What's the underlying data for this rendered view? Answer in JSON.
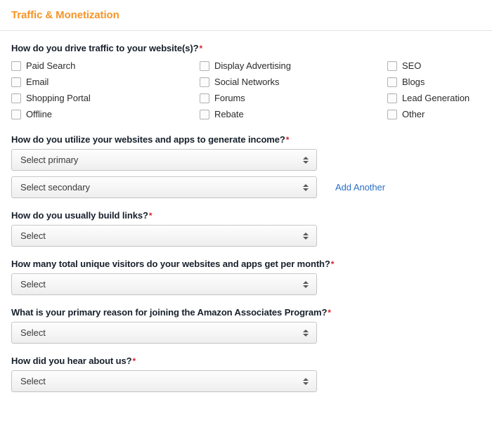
{
  "header": {
    "title": "Traffic & Monetization",
    "title_color": "#f79426"
  },
  "colors": {
    "accent": "#f79426",
    "required_asterisk": "#d9232e",
    "link": "#2b6fc4",
    "label_text": "#17202b"
  },
  "required_marker": "*",
  "questions": {
    "traffic_sources": {
      "label": "How do you drive traffic to your website(s)?",
      "required": true,
      "columns": [
        [
          "Paid Search",
          "Email",
          "Shopping Portal",
          "Offline"
        ],
        [
          "Display Advertising",
          "Social Networks",
          "Forums",
          "Rebate"
        ],
        [
          "SEO",
          "Blogs",
          "Lead Generation",
          "Other"
        ]
      ]
    },
    "monetization": {
      "label": "How do you utilize your websites and apps to generate income?",
      "required": true,
      "primary_value": "Select primary",
      "secondary_value": "Select secondary",
      "add_another_label": "Add Another"
    },
    "build_links": {
      "label": "How do you usually build links?",
      "required": true,
      "value": "Select"
    },
    "unique_visitors": {
      "label": "How many total unique visitors do your websites and apps get per month?",
      "required": true,
      "value": "Select"
    },
    "primary_reason": {
      "label": "What is your primary reason for joining the Amazon Associates Program?",
      "required": true,
      "value": "Select"
    },
    "hear_about_us": {
      "label": "How did you hear about us?",
      "required": true,
      "value": "Select"
    }
  },
  "icons": {
    "select_arrows": "sort-up-down-icon",
    "checkbox": "checkbox-unchecked-icon"
  }
}
